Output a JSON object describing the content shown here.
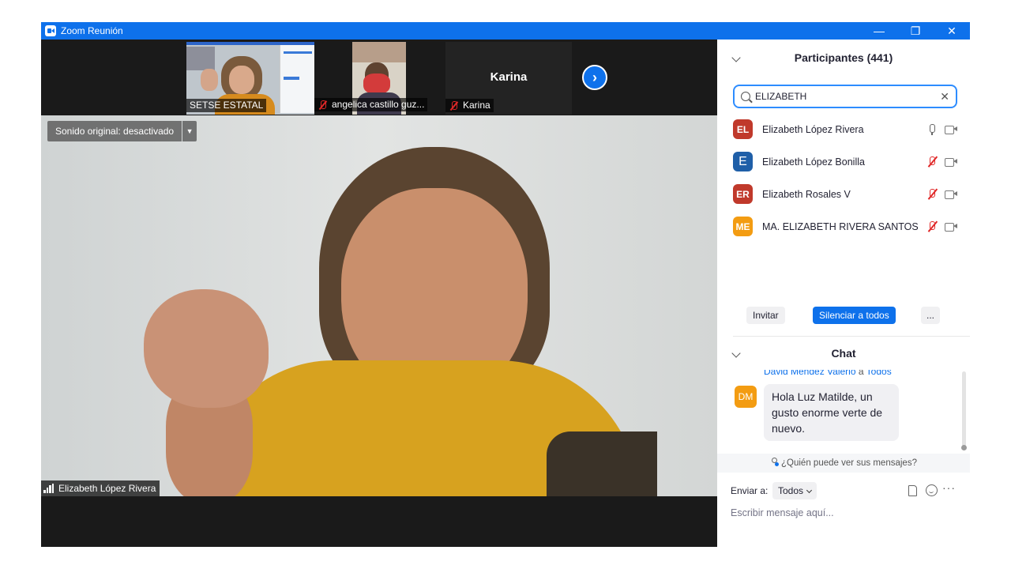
{
  "window": {
    "title": "Zoom Reunión",
    "minimize": "—",
    "restore": "❐",
    "close": "✕"
  },
  "thumbnails": [
    {
      "name": "SETSE ESTATAL",
      "muted": false
    },
    {
      "name": "angelica castillo guz...",
      "muted": true
    },
    {
      "name": "Karina",
      "muted": true,
      "display_name": "Karina"
    }
  ],
  "next_page": "›",
  "main_video": {
    "original_sound": "Sonido original: desactivado",
    "speaker": "Elizabeth López Rivera"
  },
  "participants_panel": {
    "title": "Participantes (441)",
    "search_value": "ELIZABETH",
    "clear": "✕",
    "participants": [
      {
        "initials": "EL",
        "name": "Elizabeth López Rivera",
        "color": "#c0392b",
        "mic": "on"
      },
      {
        "initials": "E",
        "name": "Elizabeth López Bonilla",
        "color": "#1f5fa8",
        "mic": "off"
      },
      {
        "initials": "ER",
        "name": "Elizabeth Rosales V",
        "color": "#c0392b",
        "mic": "off"
      },
      {
        "initials": "ME",
        "name": "MA. ELIZABETH RIVERA SANTOS",
        "color": "#f39c12",
        "mic": "off"
      }
    ],
    "invite": "Invitar",
    "mute_all": "Silenciar a todos",
    "more": "..."
  },
  "chat": {
    "title": "Chat",
    "message": {
      "sender": "David Méndez Valerio",
      "to_word": "a",
      "recipient": "Todos",
      "initials": "DM",
      "text": "Hola Luz Matilde, un gusto enorme verte de nuevo."
    },
    "privacy": "¿Quién puede ver sus mensajes?",
    "send_to_label": "Enviar a:",
    "send_to_value": "Todos",
    "more": "···",
    "placeholder": "Escribir mensaje aquí..."
  },
  "colors": {
    "accent": "#0e71eb",
    "muted_red": "#e02828"
  }
}
